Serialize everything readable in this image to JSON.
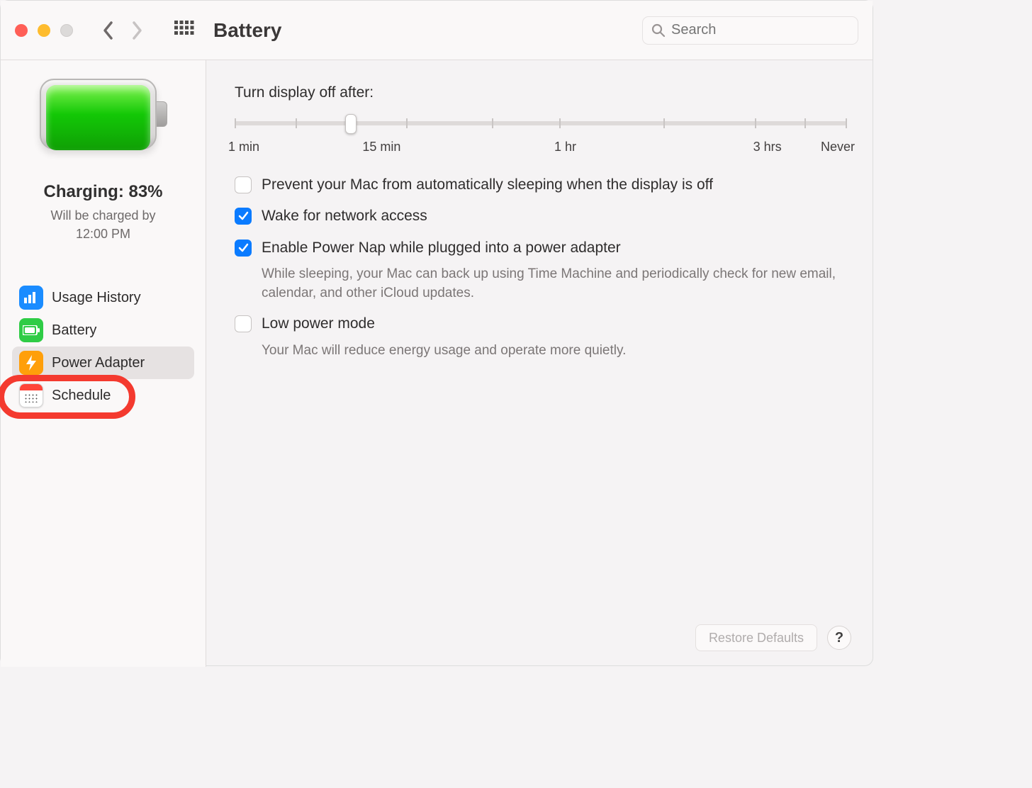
{
  "window": {
    "title": "Battery"
  },
  "search": {
    "placeholder": "Search"
  },
  "status": {
    "heading": "Charging: 83%",
    "sub_line1": "Will be charged by",
    "sub_line2": "12:00 PM"
  },
  "sidebar": {
    "items": [
      {
        "label": "Usage History"
      },
      {
        "label": "Battery"
      },
      {
        "label": "Power Adapter"
      },
      {
        "label": "Schedule"
      }
    ]
  },
  "slider": {
    "label": "Turn display off after:",
    "ticks": {
      "t0": "1 min",
      "t1": "15 min",
      "t2": "1 hr",
      "t3": "3 hrs",
      "t4": "Never"
    },
    "value_fraction_percent": 19
  },
  "options": {
    "prevent_sleep": {
      "label": "Prevent your Mac from automatically sleeping when the display is off",
      "checked": false
    },
    "wake_network": {
      "label": "Wake for network access",
      "checked": true
    },
    "power_nap": {
      "label": "Enable Power Nap while plugged into a power adapter",
      "desc": "While sleeping, your Mac can back up using Time Machine and periodically check for new email, calendar, and other iCloud updates.",
      "checked": true
    },
    "low_power": {
      "label": "Low power mode",
      "desc": "Your Mac will reduce energy usage and operate more quietly.",
      "checked": false
    }
  },
  "footer": {
    "restore_defaults": "Restore Defaults",
    "help": "?"
  },
  "annotation": {
    "highlighted_item_index": 3
  }
}
